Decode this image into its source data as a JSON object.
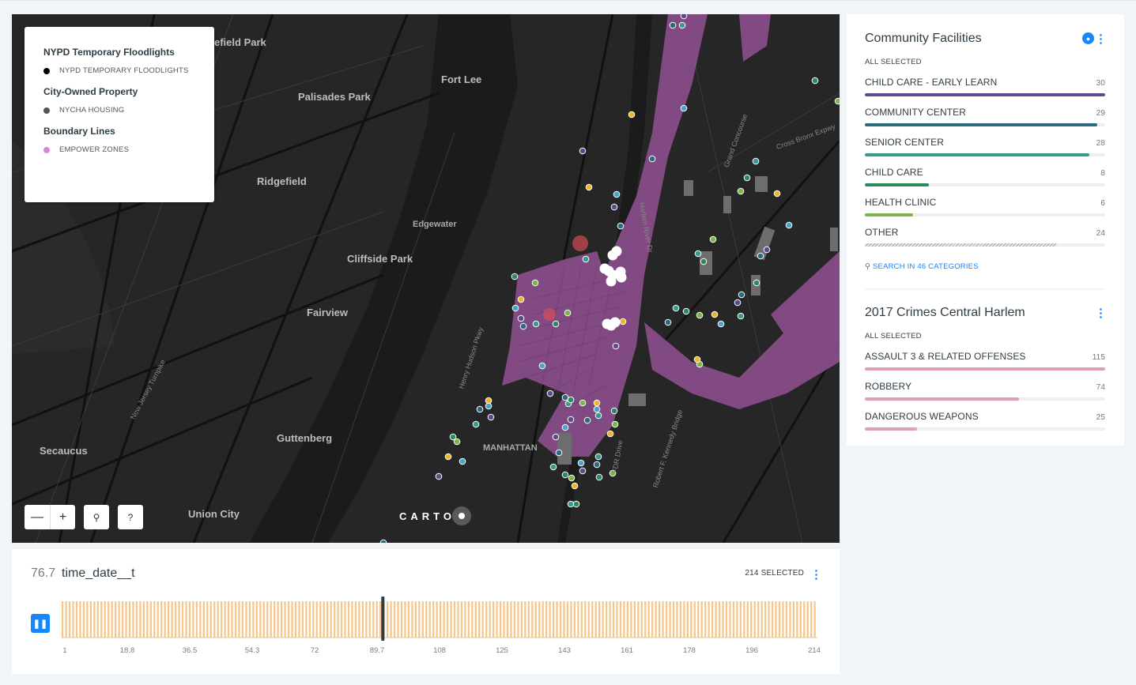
{
  "legend": {
    "groups": [
      {
        "title": "NYPD Temporary Floodlights",
        "item": "NYPD TEMPORARY FLOODLIGHTS",
        "color": "#000000"
      },
      {
        "title": "City-Owned Property",
        "item": "NYCHA HOUSING",
        "color": "#555555"
      },
      {
        "title": "Boundary Lines",
        "item": "EMPOWER ZONES",
        "color": "#d587d8"
      }
    ]
  },
  "map": {
    "labels": [
      "efield Park",
      "Fort Lee",
      "Palisades Park",
      "Ridgefield",
      "Edgewater",
      "Cliffside Park",
      "Fairview",
      "Guttenberg",
      "Secaucus",
      "Union City",
      "MANHATTAN"
    ],
    "road_labels": [
      "Henry Hudson Pkwy",
      "Cross Bronx Expwy",
      "Grand Concourse",
      "Harlem River Dr",
      "Robert F. Kennedy Bridge",
      "New Jersey Turnpike",
      "FDR Drive"
    ],
    "controls": {
      "zoom_out": "—",
      "zoom_in": "+",
      "search": "⚲",
      "help": "?"
    },
    "attribution": "CARTO"
  },
  "widgets": {
    "community": {
      "title": "Community Facilities",
      "subtitle": "ALL SELECTED",
      "search": "SEARCH IN 46 CATEGORIES",
      "categories": [
        {
          "label": "CHILD CARE - EARLY LEARN",
          "count": "30",
          "frac": 1.0,
          "color": "#5f4b8b"
        },
        {
          "label": "COMMUNITY CENTER",
          "count": "29",
          "frac": 0.967,
          "color": "#2b6a7c"
        },
        {
          "label": "SENIOR CENTER",
          "count": "28",
          "frac": 0.933,
          "color": "#3a9a8f"
        },
        {
          "label": "CHILD CARE",
          "count": "8",
          "frac": 0.267,
          "color": "#2e8a5a"
        },
        {
          "label": "HEALTH CLINIC",
          "count": "6",
          "frac": 0.2,
          "color": "#7ab648"
        },
        {
          "label": "OTHER",
          "count": "24",
          "frac": 0.8,
          "color": "#bbbbbb"
        }
      ]
    },
    "crimes": {
      "title": "2017 Crimes Central Harlem",
      "subtitle": "ALL SELECTED",
      "categories": [
        {
          "label": "ASSAULT 3 & RELATED OFFENSES",
          "count": "115",
          "frac": 1.0,
          "color": "#e0a1b7"
        },
        {
          "label": "ROBBERY",
          "count": "74",
          "frac": 0.643,
          "color": "#e0a1b7"
        },
        {
          "label": "DANGEROUS WEAPONS",
          "count": "25",
          "frac": 0.217,
          "color": "#e0a1b7"
        }
      ]
    }
  },
  "timeline": {
    "value": "76.7",
    "name": "time_date__t",
    "selected": "214 SELECTED",
    "ticks": [
      "1",
      "18.8",
      "36.5",
      "54.3",
      "72",
      "89.7",
      "108",
      "125",
      "143",
      "161",
      "178",
      "196",
      "214"
    ],
    "bar_color": "#f5c78c",
    "position": 0.425,
    "range": [
      1,
      214
    ]
  }
}
